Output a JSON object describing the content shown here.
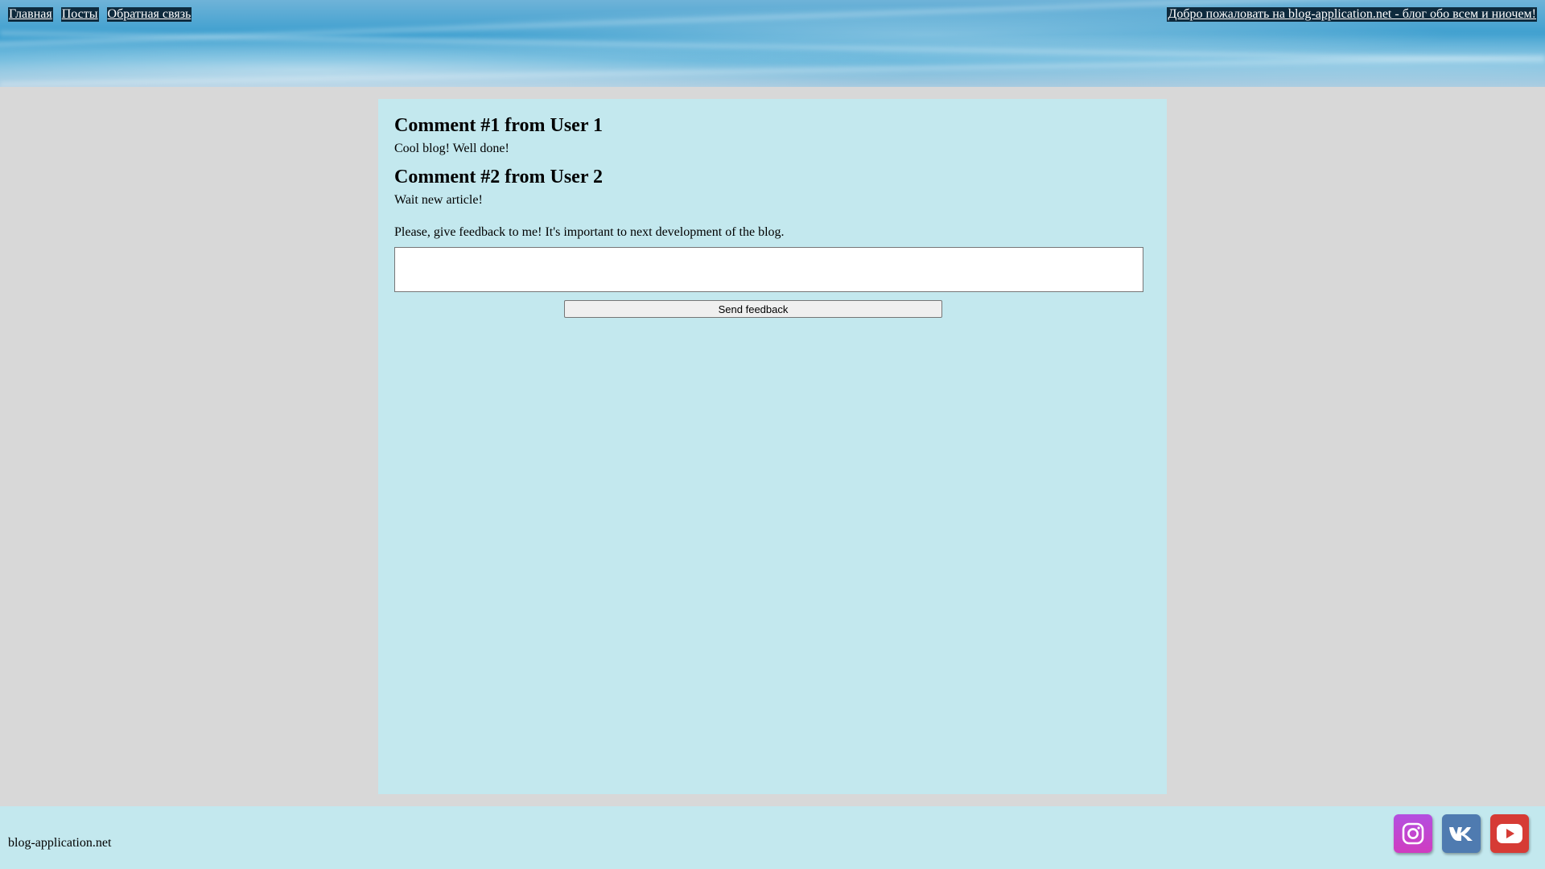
{
  "nav": {
    "items": [
      {
        "label": "Главная"
      },
      {
        "label": "Посты"
      },
      {
        "label": "Обратная связь"
      }
    ],
    "welcome": "Добро пожаловать на blog-application.net - блог обо всем и ниочем!"
  },
  "comments": [
    {
      "title": "Comment #1 from User 1",
      "text": "Cool blog! Well done!"
    },
    {
      "title": "Comment #2 from User 2",
      "text": "Wait new article!"
    }
  ],
  "feedback": {
    "prompt": "Please, give feedback to me! It's important to next development of the blog.",
    "value": "",
    "send_label": "Send feedback"
  },
  "footer": {
    "site": "blog-application.net",
    "socials": [
      {
        "name": "instagram-icon",
        "color": "#c13fd0"
      },
      {
        "name": "vk-icon",
        "color": "#4f7bb0"
      },
      {
        "name": "youtube-icon",
        "color": "#d63b35"
      }
    ]
  },
  "colors": {
    "content_bg": "#c3e8ee",
    "page_bg": "#d8d8d8",
    "nav_link_bg": "#0e2a3d"
  }
}
